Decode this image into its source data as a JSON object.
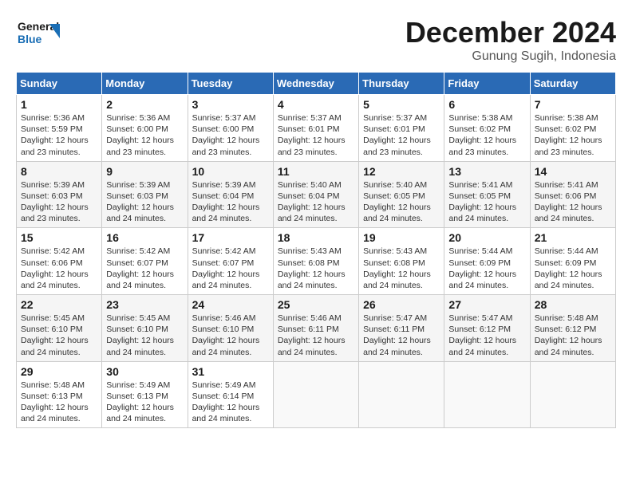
{
  "header": {
    "logo_line1": "General",
    "logo_line2": "Blue",
    "month": "December 2024",
    "location": "Gunung Sugih, Indonesia"
  },
  "weekdays": [
    "Sunday",
    "Monday",
    "Tuesday",
    "Wednesday",
    "Thursday",
    "Friday",
    "Saturday"
  ],
  "weeks": [
    [
      {
        "day": "1",
        "info": "Sunrise: 5:36 AM\nSunset: 5:59 PM\nDaylight: 12 hours\nand 23 minutes."
      },
      {
        "day": "2",
        "info": "Sunrise: 5:36 AM\nSunset: 6:00 PM\nDaylight: 12 hours\nand 23 minutes."
      },
      {
        "day": "3",
        "info": "Sunrise: 5:37 AM\nSunset: 6:00 PM\nDaylight: 12 hours\nand 23 minutes."
      },
      {
        "day": "4",
        "info": "Sunrise: 5:37 AM\nSunset: 6:01 PM\nDaylight: 12 hours\nand 23 minutes."
      },
      {
        "day": "5",
        "info": "Sunrise: 5:37 AM\nSunset: 6:01 PM\nDaylight: 12 hours\nand 23 minutes."
      },
      {
        "day": "6",
        "info": "Sunrise: 5:38 AM\nSunset: 6:02 PM\nDaylight: 12 hours\nand 23 minutes."
      },
      {
        "day": "7",
        "info": "Sunrise: 5:38 AM\nSunset: 6:02 PM\nDaylight: 12 hours\nand 23 minutes."
      }
    ],
    [
      {
        "day": "8",
        "info": "Sunrise: 5:39 AM\nSunset: 6:03 PM\nDaylight: 12 hours\nand 23 minutes."
      },
      {
        "day": "9",
        "info": "Sunrise: 5:39 AM\nSunset: 6:03 PM\nDaylight: 12 hours\nand 24 minutes."
      },
      {
        "day": "10",
        "info": "Sunrise: 5:39 AM\nSunset: 6:04 PM\nDaylight: 12 hours\nand 24 minutes."
      },
      {
        "day": "11",
        "info": "Sunrise: 5:40 AM\nSunset: 6:04 PM\nDaylight: 12 hours\nand 24 minutes."
      },
      {
        "day": "12",
        "info": "Sunrise: 5:40 AM\nSunset: 6:05 PM\nDaylight: 12 hours\nand 24 minutes."
      },
      {
        "day": "13",
        "info": "Sunrise: 5:41 AM\nSunset: 6:05 PM\nDaylight: 12 hours\nand 24 minutes."
      },
      {
        "day": "14",
        "info": "Sunrise: 5:41 AM\nSunset: 6:06 PM\nDaylight: 12 hours\nand 24 minutes."
      }
    ],
    [
      {
        "day": "15",
        "info": "Sunrise: 5:42 AM\nSunset: 6:06 PM\nDaylight: 12 hours\nand 24 minutes."
      },
      {
        "day": "16",
        "info": "Sunrise: 5:42 AM\nSunset: 6:07 PM\nDaylight: 12 hours\nand 24 minutes."
      },
      {
        "day": "17",
        "info": "Sunrise: 5:42 AM\nSunset: 6:07 PM\nDaylight: 12 hours\nand 24 minutes."
      },
      {
        "day": "18",
        "info": "Sunrise: 5:43 AM\nSunset: 6:08 PM\nDaylight: 12 hours\nand 24 minutes."
      },
      {
        "day": "19",
        "info": "Sunrise: 5:43 AM\nSunset: 6:08 PM\nDaylight: 12 hours\nand 24 minutes."
      },
      {
        "day": "20",
        "info": "Sunrise: 5:44 AM\nSunset: 6:09 PM\nDaylight: 12 hours\nand 24 minutes."
      },
      {
        "day": "21",
        "info": "Sunrise: 5:44 AM\nSunset: 6:09 PM\nDaylight: 12 hours\nand 24 minutes."
      }
    ],
    [
      {
        "day": "22",
        "info": "Sunrise: 5:45 AM\nSunset: 6:10 PM\nDaylight: 12 hours\nand 24 minutes."
      },
      {
        "day": "23",
        "info": "Sunrise: 5:45 AM\nSunset: 6:10 PM\nDaylight: 12 hours\nand 24 minutes."
      },
      {
        "day": "24",
        "info": "Sunrise: 5:46 AM\nSunset: 6:10 PM\nDaylight: 12 hours\nand 24 minutes."
      },
      {
        "day": "25",
        "info": "Sunrise: 5:46 AM\nSunset: 6:11 PM\nDaylight: 12 hours\nand 24 minutes."
      },
      {
        "day": "26",
        "info": "Sunrise: 5:47 AM\nSunset: 6:11 PM\nDaylight: 12 hours\nand 24 minutes."
      },
      {
        "day": "27",
        "info": "Sunrise: 5:47 AM\nSunset: 6:12 PM\nDaylight: 12 hours\nand 24 minutes."
      },
      {
        "day": "28",
        "info": "Sunrise: 5:48 AM\nSunset: 6:12 PM\nDaylight: 12 hours\nand 24 minutes."
      }
    ],
    [
      {
        "day": "29",
        "info": "Sunrise: 5:48 AM\nSunset: 6:13 PM\nDaylight: 12 hours\nand 24 minutes."
      },
      {
        "day": "30",
        "info": "Sunrise: 5:49 AM\nSunset: 6:13 PM\nDaylight: 12 hours\nand 24 minutes."
      },
      {
        "day": "31",
        "info": "Sunrise: 5:49 AM\nSunset: 6:14 PM\nDaylight: 12 hours\nand 24 minutes."
      },
      {
        "day": "",
        "info": ""
      },
      {
        "day": "",
        "info": ""
      },
      {
        "day": "",
        "info": ""
      },
      {
        "day": "",
        "info": ""
      }
    ]
  ]
}
